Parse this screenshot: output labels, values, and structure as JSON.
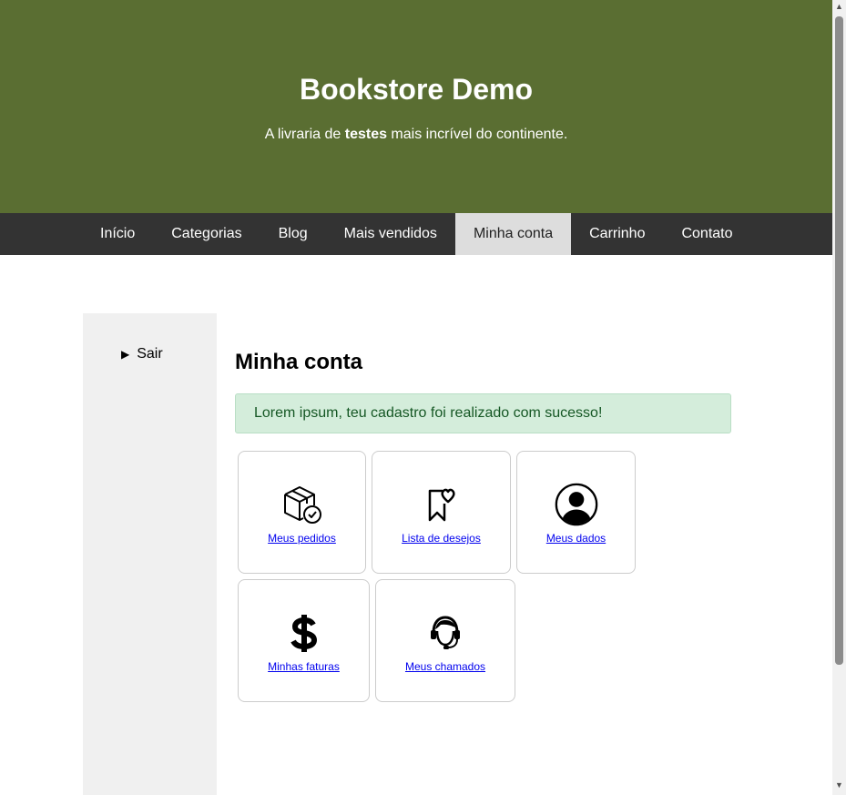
{
  "header": {
    "title": "Bookstore Demo",
    "tagline_prefix": "A livraria de ",
    "tagline_bold": "testes",
    "tagline_suffix": " mais incrível do continente."
  },
  "nav": {
    "items": [
      "Início",
      "Categorias",
      "Blog",
      "Mais vendidos",
      "Minha conta",
      "Carrinho",
      "Contato"
    ],
    "active": "Minha conta"
  },
  "sidebar": {
    "sair_label": "Sair"
  },
  "main": {
    "title": "Minha conta",
    "alert": "Lorem ipsum, teu cadastro foi realizado com sucesso!",
    "cards": [
      {
        "label": "Meus pedidos",
        "icon": "package-check-icon"
      },
      {
        "label": "Lista de desejos",
        "icon": "bookmark-heart-icon"
      },
      {
        "label": "Meus dados",
        "icon": "user-circle-icon"
      },
      {
        "label": "Minhas faturas",
        "icon": "dollar-icon"
      },
      {
        "label": "Meus chamados",
        "icon": "headset-icon"
      }
    ]
  }
}
